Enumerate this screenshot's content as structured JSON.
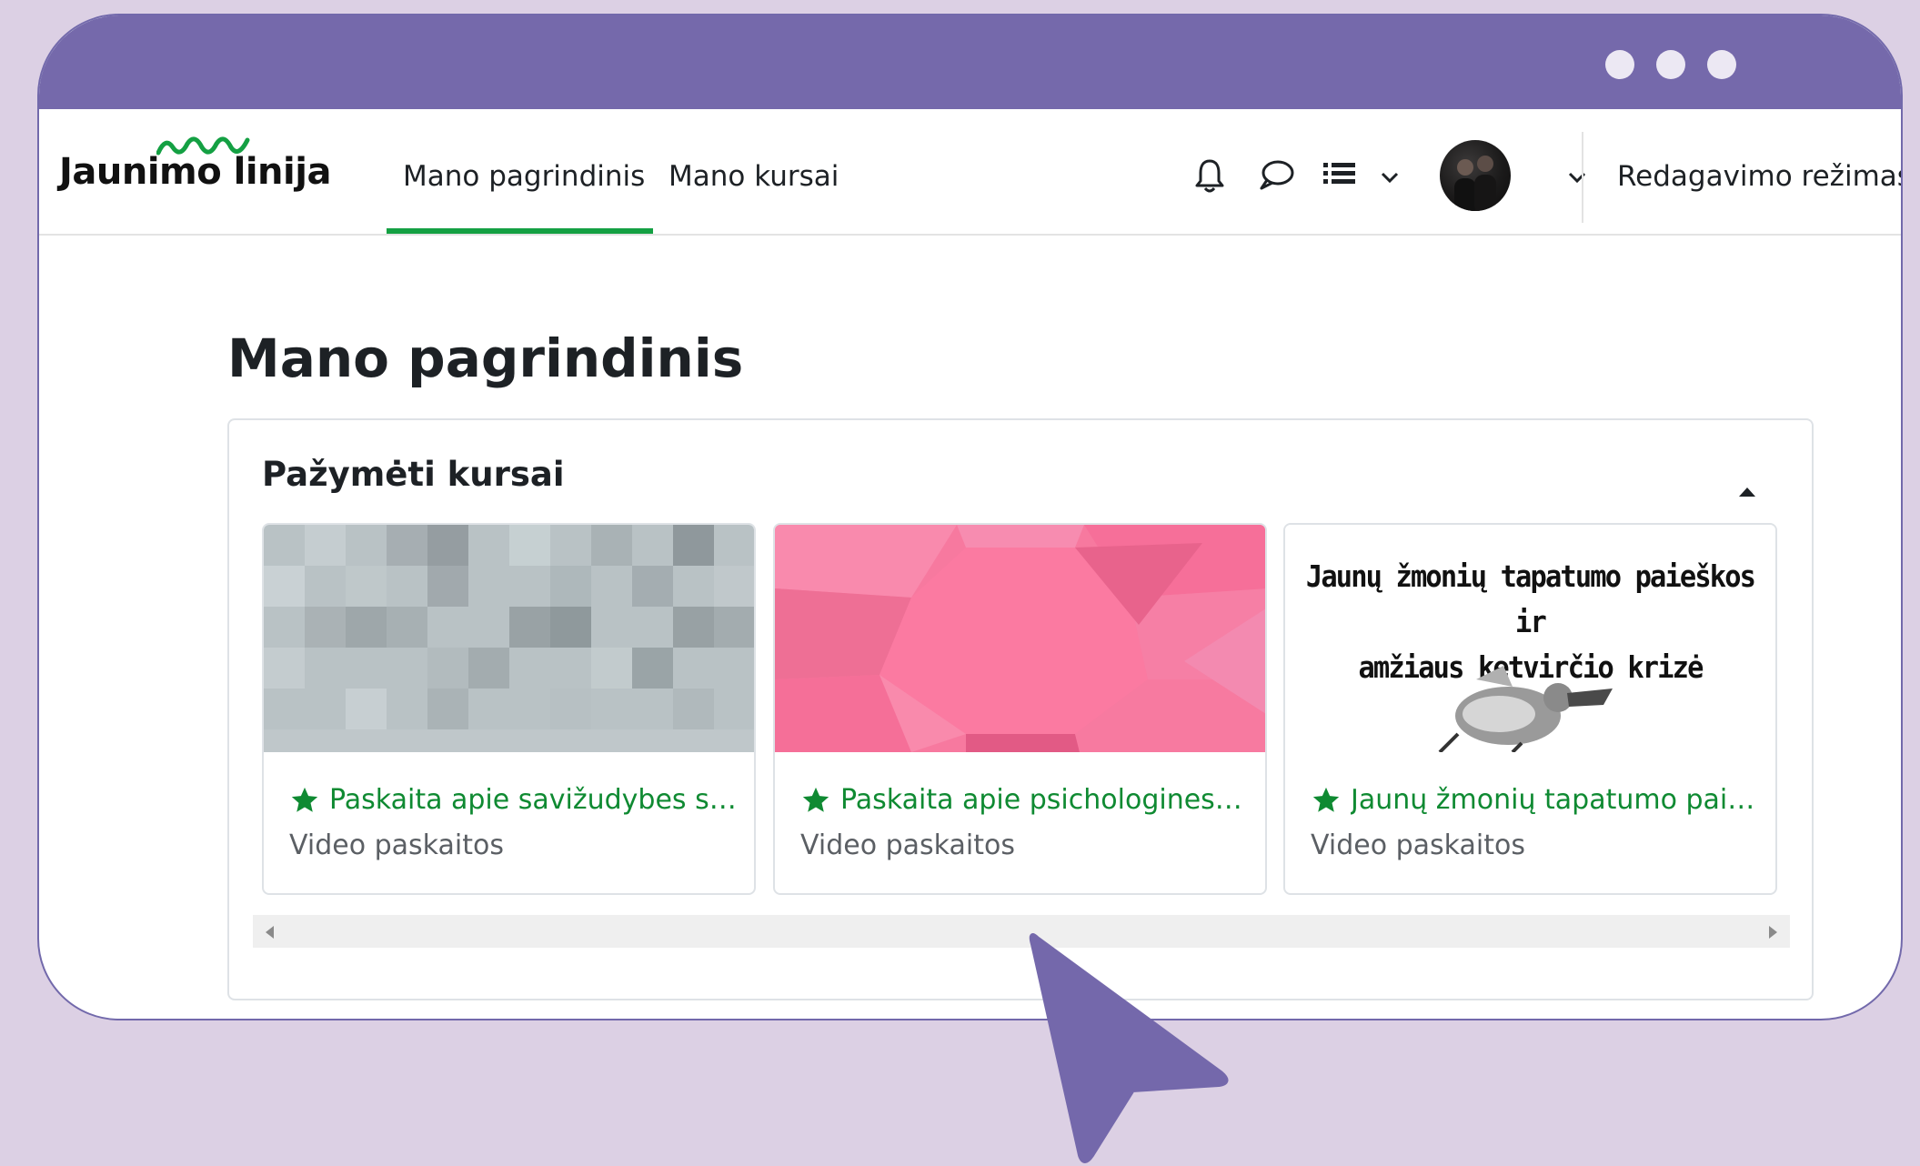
{
  "nav": {
    "logo_text": "Jaunimo linija",
    "links": [
      "Mano pagrindinis",
      "Mano kursai"
    ],
    "edit_mode": "Redagavimo režimas"
  },
  "page": {
    "title": "Mano pagrindinis"
  },
  "block": {
    "title": "Pažymėti kursai",
    "courses": [
      {
        "name": "Paskaita apie savižudybes su ...",
        "category": "Video paskaitos"
      },
      {
        "name": "Paskaita apie psichologines tr...",
        "category": "Video paskaitos"
      },
      {
        "name": "Jaunų žmonių tapatumo paie...",
        "category": "Video paskaitos",
        "image_text": [
          "Jaunų žmonių tapatumo paieškos ir",
          "amžiaus ketvirčio krizė"
        ]
      }
    ]
  },
  "colors": {
    "frame": "#7569ab",
    "background": "#dcd0e4",
    "accent_green": "#14a043",
    "link_green": "#0f8a32"
  },
  "icons": [
    "bell-icon",
    "chat-icon",
    "list-icon",
    "chevron-down-icon",
    "star-icon",
    "caret-up-icon",
    "arrow-pointer-icon"
  ]
}
